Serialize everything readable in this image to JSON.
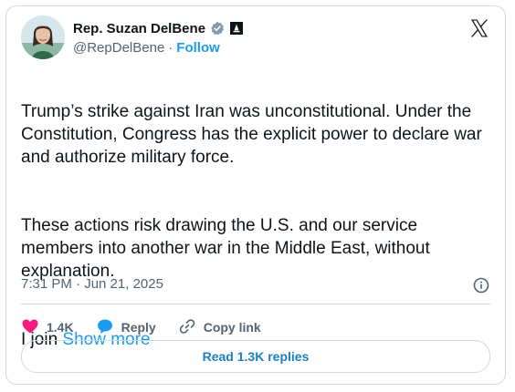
{
  "author": {
    "display_name": "Rep. Suzan DelBene",
    "handle": "@RepDelBene",
    "separator": "·",
    "follow_label": "Follow"
  },
  "tweet": {
    "paragraph_1": "Trump’s strike against Iran was unconstitutional. Under the Constitution, Congress has the explicit power to declare war and authorize military force.",
    "paragraph_2": "These actions risk drawing the U.S. and our service members into another war in the Middle East, without explanation.",
    "paragraph_3_prefix": "I join ",
    "show_more_label": "Show more",
    "timestamp": "7:31 PM · Jun 21, 2025"
  },
  "actions": {
    "like_count": "1.4K",
    "reply_label": "Reply",
    "copy_link_label": "Copy link",
    "read_replies_label": "Read 1.3K replies"
  },
  "colors": {
    "accent": "#1d9bf0",
    "like": "#f91880",
    "text": "#0f1419",
    "secondary": "#536471",
    "border": "#cfd9de"
  },
  "icons": [
    "verified-badge-icon",
    "government-label-icon",
    "x-logo-icon",
    "info-icon",
    "heart-icon",
    "reply-bubble-icon",
    "link-icon"
  ]
}
